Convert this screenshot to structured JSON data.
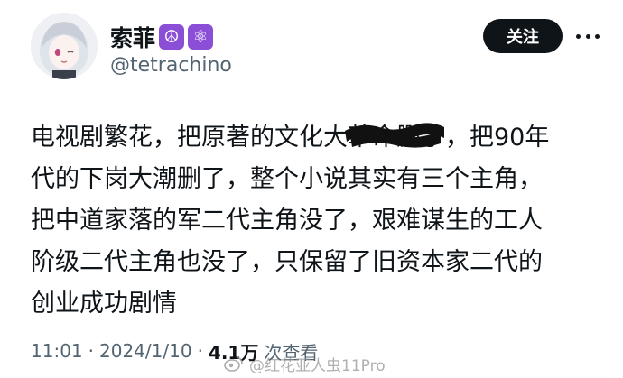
{
  "profile": {
    "display_name": "索菲",
    "badge_1": "☮",
    "badge_2": "⚛",
    "handle": "@tetrachino",
    "avatar_icon": "anime-avatar"
  },
  "actions": {
    "follow_label": "关注",
    "more_icon": "more-horizontal-icon"
  },
  "tweet": {
    "lines": [
      "电视剧繁花，把原著的文化大革命删了，把90年",
      "代的下岗大潮删了，整个小说其实有三个主角，",
      "把中道家落的军二代主角没了，艰难谋生的工人",
      "阶级二代主角也没了，只保留了旧资本家二代的",
      "创业成功剧情"
    ]
  },
  "meta": {
    "time": "11:01",
    "separator": "·",
    "date": "2024/1/10",
    "views": "4.1万",
    "views_label": "次查看"
  },
  "watermark": {
    "text": "@红花亚人虫11Pro",
    "icon": "weibo-logo-icon"
  },
  "colors": {
    "text": "#0f1419",
    "muted": "#536471",
    "badge": "#8a4fd6",
    "button_bg": "#0f1419"
  }
}
